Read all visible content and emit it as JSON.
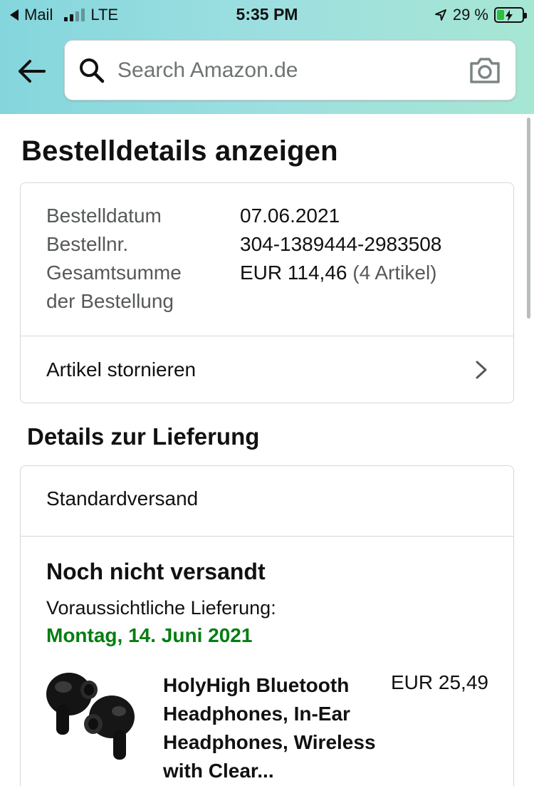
{
  "status_bar": {
    "back_app": "Mail",
    "network": "LTE",
    "time": "5:35 PM",
    "battery_percent": "29 %",
    "icons": [
      "back-triangle-icon",
      "signal-icon",
      "location-arrow-icon",
      "battery-charging-icon"
    ]
  },
  "search": {
    "placeholder": "Search Amazon.de",
    "icons": [
      "back-arrow-icon",
      "search-icon",
      "camera-icon"
    ]
  },
  "page": {
    "title": "Bestelldetails anzeigen"
  },
  "order": {
    "date_label": "Bestelldatum",
    "date_value": "07.06.2021",
    "number_label": "Bestellnr.",
    "number_value": "304-1389444-2983508",
    "total_label_line1": "Gesamtsumme",
    "total_label_line2": "der Bestellung",
    "total_value": "EUR 114,46",
    "total_items": "(4 Artikel)",
    "cancel_label": "Artikel stornieren"
  },
  "delivery": {
    "section_title": "Details zur Lieferung",
    "method": "Standardversand",
    "status": "Noch nicht versandt",
    "eta_label": "Voraussichtliche Lieferung:",
    "eta_date": "Montag, 14. Juni 2021",
    "eta_color": "#067d12"
  },
  "product": {
    "title": "HolyHigh Bluetooth Headphones, In-Ear Headphones, Wireless with Clear...",
    "price": "EUR 25,49"
  }
}
